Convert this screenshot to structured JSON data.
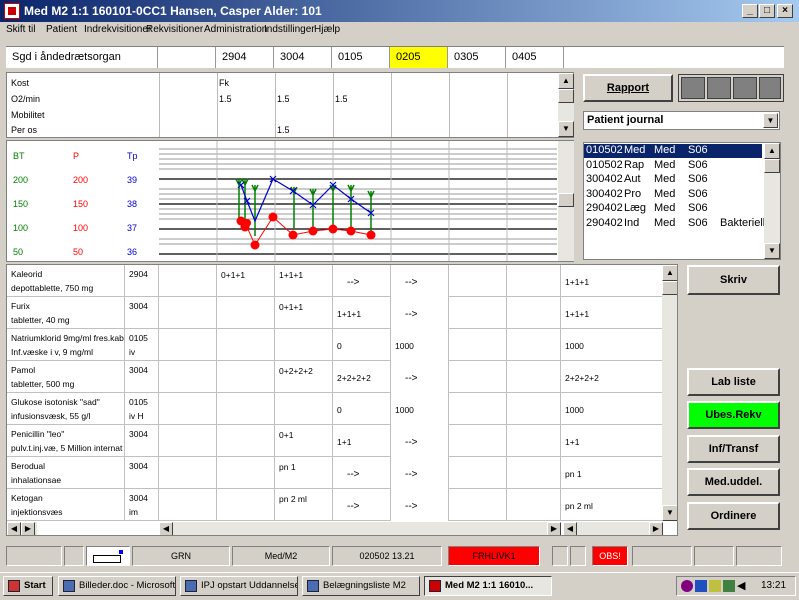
{
  "window": {
    "title": "Med  M2   1:1   160101-0CC1  Hansen, Casper   Alder:  101"
  },
  "menu": [
    "Skift til",
    "Patient",
    "Indrekvisitioner",
    "Rekvisitioner",
    "Administration",
    "Indstillinger",
    "Hjælp"
  ],
  "header": {
    "label": "Sgd i åndedrætsorgan",
    "dates": [
      "2904",
      "3004",
      "0105",
      "0205",
      "0305",
      "0405"
    ],
    "highlight_color": "#ffff00"
  },
  "obs": {
    "labels": [
      "Kost",
      "O2/min",
      "Mobilitet",
      "Per os"
    ],
    "values": [
      {
        "col": 0,
        "row": 0,
        "text": "Fk"
      },
      {
        "col": 0,
        "row": 1,
        "text": "1.5"
      },
      {
        "col": 1,
        "row": 1,
        "text": "1.5"
      },
      {
        "col": 2,
        "row": 1,
        "text": "1.5"
      },
      {
        "col": 1,
        "row": 3,
        "text": "1.5"
      }
    ]
  },
  "vitals": {
    "headers": {
      "bt": "BT",
      "p": "P",
      "tp": "Tp"
    },
    "bt_scale": [
      "200",
      "150",
      "100",
      "50"
    ],
    "p_scale": [
      "200",
      "150",
      "100",
      "50"
    ],
    "tp_scale": [
      "39",
      "38",
      "37",
      "36"
    ],
    "colors": {
      "bt": "#008000",
      "p": "#ff0000",
      "tp": "#0000cc"
    }
  },
  "rapport": {
    "label": "Rapport"
  },
  "journal_select": {
    "value": "Patient journal"
  },
  "journal_list": [
    [
      "010502",
      "Med",
      "Med",
      "S06",
      ""
    ],
    [
      "010502",
      "Rap",
      "Med",
      "S06",
      ""
    ],
    [
      "300402",
      "Aut",
      "Med",
      "S06",
      ""
    ],
    [
      "300402",
      "Pro",
      "Med",
      "S06",
      ""
    ],
    [
      "290402",
      "Læg",
      "Med",
      "S06",
      ""
    ],
    [
      "290402",
      "Ind",
      "Med",
      "S06",
      "Bakterielle"
    ]
  ],
  "meds": [
    {
      "name": "Kaleorid",
      "form": "depottablette, 750 mg",
      "start": "2904",
      "route": "",
      "c0": "0+1+1",
      "c1": "1+1+1",
      "c2": "-->",
      "c3": "-->",
      "c3white": true,
      "total": "1+1+1"
    },
    {
      "name": "Furix",
      "form": "tabletter, 40 mg",
      "start": "3004",
      "route": "",
      "c0": "",
      "c1": "0+1+1",
      "c2": "1+1+1",
      "c3": "-->",
      "c3white": true,
      "total": "1+1+1"
    },
    {
      "name": "Natriumklorid 9mg/ml fres.kab",
      "form": "Inf.væske i v, 9 mg/ml",
      "start": "0105",
      "route": "iv",
      "c0": "",
      "c1": "",
      "c2": "0",
      "c3": "1000",
      "c3white": true,
      "total": "1000"
    },
    {
      "name": "Pamol",
      "form": "tabletter, 500 mg",
      "start": "3004",
      "route": "",
      "c0": "",
      "c1": "0+2+2+2",
      "c2": "2+2+2+2",
      "c3": "-->",
      "c3white": true,
      "total": "2+2+2+2"
    },
    {
      "name": "Glukose isotonisk \"sad\"",
      "form": "infusionsvæsk, 55 g/l",
      "start": "0105",
      "route": "iv   H",
      "c0": "",
      "c1": "",
      "c2": "0",
      "c3": "1000",
      "c3white": true,
      "total": "1000"
    },
    {
      "name": "Penicillin \"leo\"",
      "form": "pulv.t.inj.væ, 5 Million internat",
      "start": "3004",
      "route": "",
      "c0": "",
      "c1": "0+1",
      "c2": "1+1",
      "c3": "-->",
      "c3white": true,
      "total": "1+1"
    },
    {
      "name": "Berodual",
      "form": "inhalationsae",
      "start": "3004",
      "route": "",
      "c0": "",
      "c1": "pn 1",
      "c2": "-->",
      "c3": "-->",
      "c3white": true,
      "total": "pn 1"
    },
    {
      "name": "Ketogan",
      "form": "injektionsvæs",
      "start": "3004",
      "route": "im",
      "c0": "",
      "c1": "pn 2 ml",
      "c2": "-->",
      "c3": "-->",
      "c3white": true,
      "total": "pn 2 ml"
    }
  ],
  "buttons": {
    "skriv": "Skriv",
    "lab_liste": "Lab liste",
    "ubes_rekv": "Ubes.Rekv",
    "inf_transf": "Inf/Transf",
    "med_uddel": "Med.uddel.",
    "ordinere": "Ordinere",
    "ubes_color": "#00ff00"
  },
  "statusbar": {
    "grn": "GRN",
    "medm2": "Med/M2",
    "datetime": "020502  13.21",
    "frhlivk": "FRHLIVK1",
    "obs": "OBS!",
    "alert_color": "#ff0000"
  },
  "taskbar": {
    "start": "Start",
    "items": [
      "Billeder.doc - Microsoft ...",
      "IPJ opstart Uddannelse",
      "Belægningsliste M2",
      "Med   M2   1:1   16010..."
    ],
    "clock": "13:21"
  }
}
